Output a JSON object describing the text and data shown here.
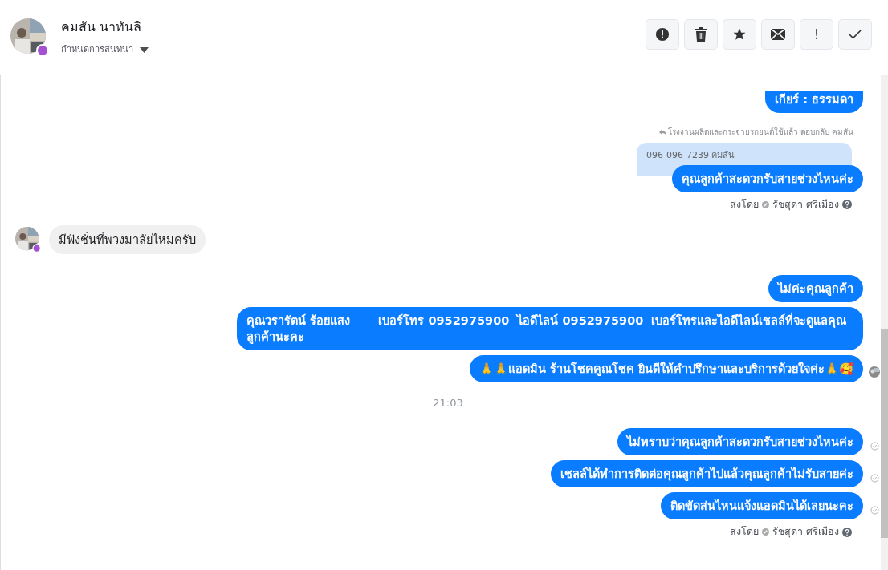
{
  "header": {
    "name": "คมสัน นาทันลิ",
    "subtitle": "กำหนดการสนทนา"
  },
  "toolbar": [
    {
      "kind": "alert"
    },
    {
      "kind": "trash"
    },
    {
      "kind": "star"
    },
    {
      "kind": "mail"
    },
    {
      "kind": "bang",
      "label": "!"
    },
    {
      "kind": "check"
    }
  ],
  "messages": [
    {
      "kind": "outgoing",
      "text": "เกียร์ : ธรรมดา",
      "cut_top": true
    },
    {
      "kind": "reply_note",
      "text": "โรงงานผลิตและกระจายรถยนต์ใช้แล้ว ตอบกลับ คมสัน"
    },
    {
      "kind": "quoted",
      "text": "096-096-7239 คมสัน"
    },
    {
      "kind": "outgoing",
      "text": "คุณลูกค้าสะดวกรับสายช่วงไหนค่ะ",
      "attached": true
    },
    {
      "kind": "sent_by",
      "prefix": "ส่งโดย",
      "name": "รัชสุดา ศรีเมือง"
    },
    {
      "kind": "incoming",
      "text": "มีฟังชั่นที่พวงมาลัยไหมครับ"
    },
    {
      "kind": "outgoing",
      "text": "ไม่ค่ะคุณลูกค้า"
    },
    {
      "kind": "outgoing",
      "text": "คุณวรารัตน์ ร้อยแสง       เบอร์โทร 0952975900  ไอดีไลน์ 0952975900  เบอร์โทรและไอดีไลน์เชลล์ที่จะดูแลคุณลูกค้านะคะ"
    },
    {
      "kind": "outgoing",
      "text": "🙏🙏แอดมิน ร้านโชคคูณโชค ยินดีให้คำปรึกษาและบริการด้วยใจค่ะ🙏🥰",
      "seen": true
    },
    {
      "kind": "time",
      "text": "21:03"
    },
    {
      "kind": "outgoing",
      "text": "ไม่ทราบว่าคุณลูกค้าสะดวกรับสายช่วงไหนค่ะ",
      "delivered": true
    },
    {
      "kind": "outgoing",
      "text": "เชลล์ได้ทำการติดต่อคุณลูกค้าไปแล้วคุณลูกค้าไม่รับสายค่ะ",
      "delivered": true
    },
    {
      "kind": "outgoing",
      "text": "ติดขัดส่นไหนแจ้งแอดมินได้เลยนะคะ",
      "delivered": true
    },
    {
      "kind": "sent_by",
      "prefix": "ส่งโดย",
      "name": "รัชสุดา ศรีเมือง"
    }
  ]
}
